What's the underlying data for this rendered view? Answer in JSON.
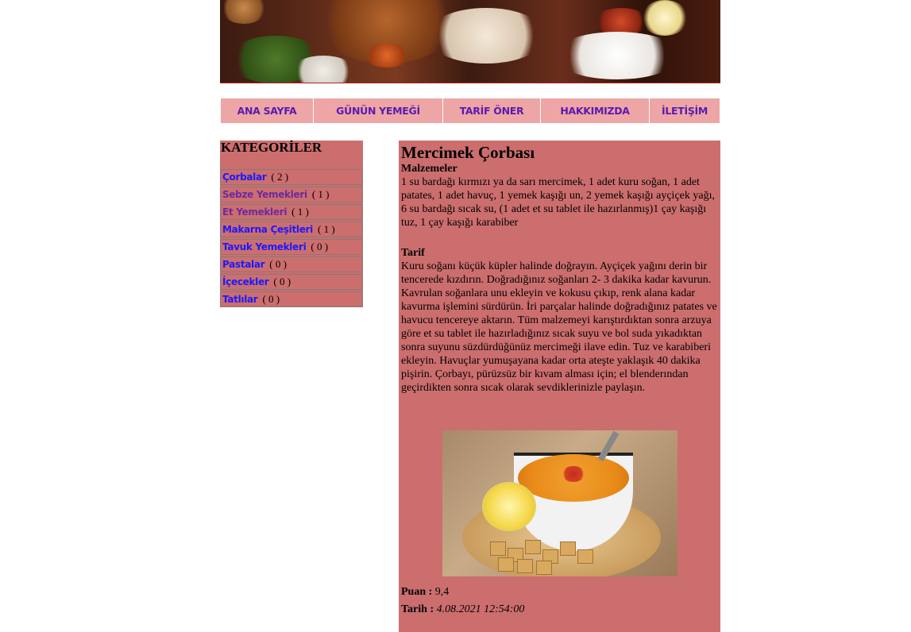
{
  "nav": {
    "items": [
      "ANA SAYFA",
      "GÜNÜN YEMEĞİ",
      "TARİF ÖNER",
      "HAKKIMIZDA",
      "İLETİŞİM"
    ]
  },
  "sidebar": {
    "title": "KATEGORİLER",
    "categories": [
      {
        "name": "Çorbalar",
        "count": "( 2 )"
      },
      {
        "name": "Sebze Yemekleri",
        "count": "( 1 )"
      },
      {
        "name": "Et Yemekleri",
        "count": "( 1 )"
      },
      {
        "name": "Makarna Çeşitleri",
        "count": "( 1 )"
      },
      {
        "name": "Tavuk Yemekleri",
        "count": "( 0 )"
      },
      {
        "name": "Pastalar",
        "count": "( 0 )"
      },
      {
        "name": "İçecekler",
        "count": "( 0 )"
      },
      {
        "name": "Tatlılar",
        "count": "( 0 )"
      }
    ]
  },
  "recipe": {
    "title": "Mercimek Çorbası",
    "ingredients_label": "Malzemeler",
    "ingredients": "1 su bardağı kırmızı ya da sarı mercimek, 1 adet kuru soğan, 1 adet patates, 1 adet havuç, 1 yemek kaşığı un, 2 yemek kaşığı ayçiçek yağı, 6 su bardağı sıcak su, (1 adet et su tablet ile hazırlanmış)1 çay kaşığı tuz, 1 çay kaşığı karabiber",
    "recipe_label": "Tarif",
    "instructions": "Kuru soğanı küçük küpler halinde doğrayın. Ayçiçek yağını derin bir tencerede kızdırın. Doğradığınız soğanları 2- 3 dakika kadar kavurun. Kavrulan soğanlara unu ekleyin ve kokusu çıkıp, renk alana kadar kavurma işlemini sürdürün. İri parçalar halinde doğradığınız patates ve havucu tencereye aktarın. Tüm malzemeyi karıştırdıktan sonra arzuya göre et su tablet ile hazırladığınız sıcak suyu ve bol suda yıkadıktan sonra suyunu süzdürdüğünüz mercimeği ilave edin. Tuz ve karabiberi ekleyin. Havuçlar yumuşayana kadar orta ateşte yaklaşık 40 dakika pişirin. Çorbayı, pürüzsüz bir kıvam alması için; el blenderından geçirdikten sonra sıcak olarak sevdiklerinizle paylaşın.",
    "score_label": "Puan :",
    "score": "9,4",
    "date_label": "Tarih :",
    "date": "4.08.2021 12:54:00"
  }
}
